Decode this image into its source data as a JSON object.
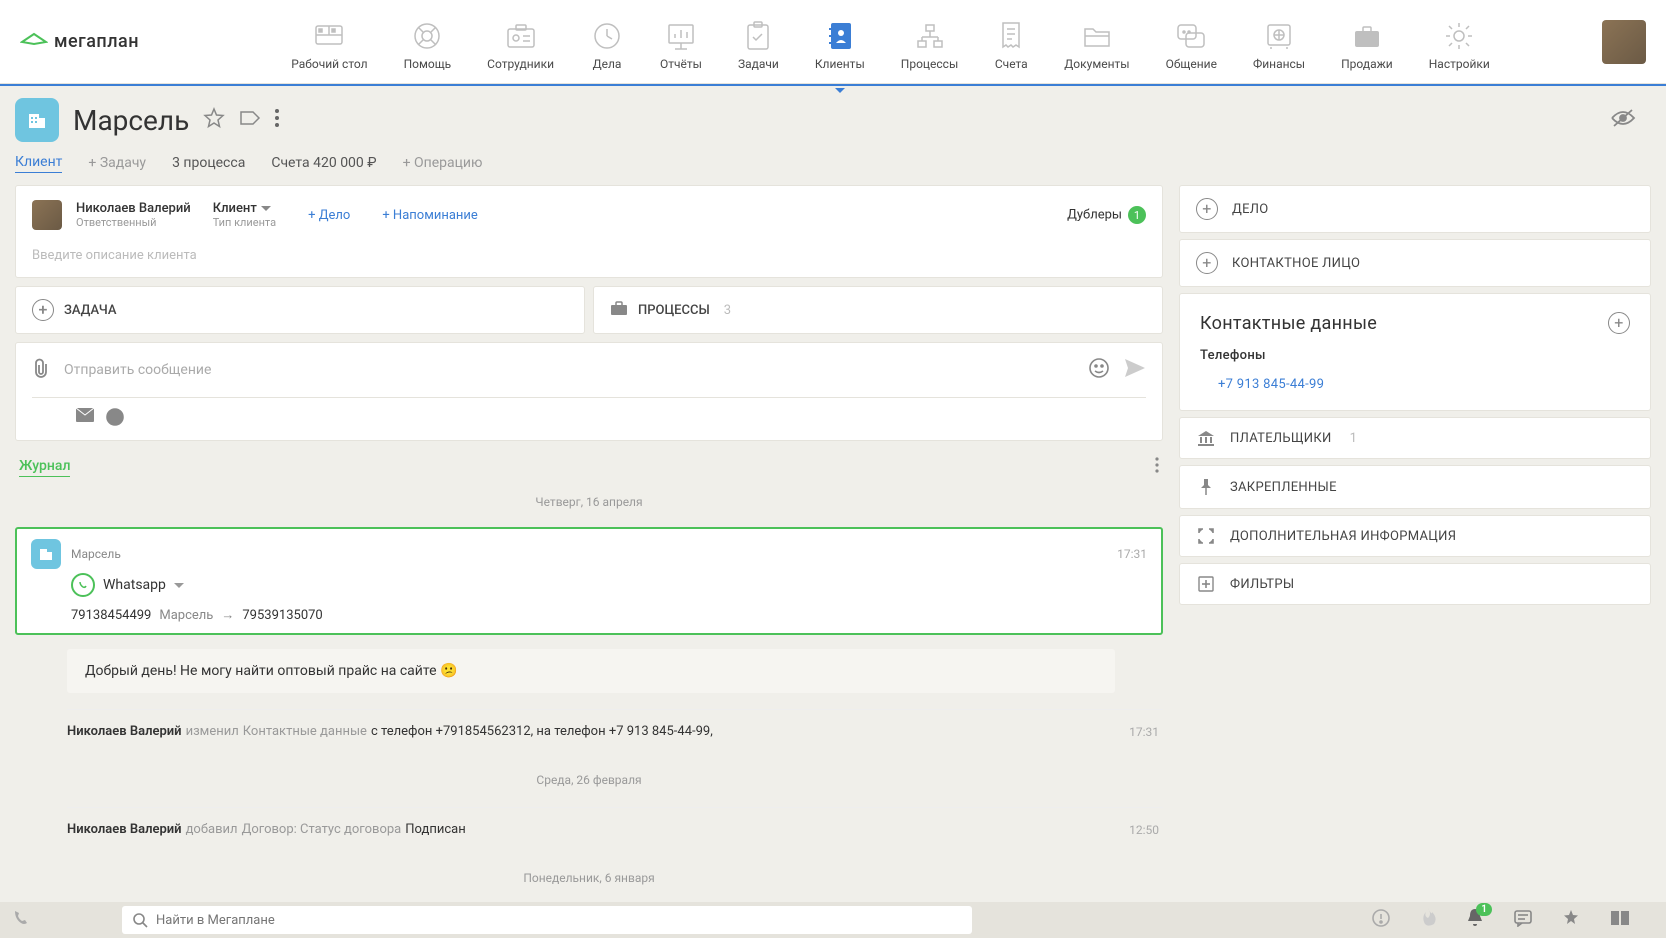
{
  "nav": {
    "items": [
      {
        "label": "Рабочий стол"
      },
      {
        "label": "Помощь"
      },
      {
        "label": "Сотрудники"
      },
      {
        "label": "Дела"
      },
      {
        "label": "Отчёты"
      },
      {
        "label": "Задачи"
      },
      {
        "label": "Клиенты"
      },
      {
        "label": "Процессы"
      },
      {
        "label": "Счета"
      },
      {
        "label": "Документы"
      },
      {
        "label": "Общение"
      },
      {
        "label": "Финансы"
      },
      {
        "label": "Продажи"
      },
      {
        "label": "Настройки"
      }
    ]
  },
  "logo_text": "мегаплан",
  "page_title": "Марсель",
  "tabs": {
    "client": "Клиент",
    "add_task": "+ Задачу",
    "processes": "3 процесса",
    "accounts": "Счета 420 000 ₽",
    "add_operation": "+ Операцию"
  },
  "responsible": {
    "name": "Николаев Валерий",
    "role": "Ответственный",
    "type_label": "Клиент",
    "type_sub": "Тип клиента",
    "add_deal": "+ Дело",
    "add_reminder": "+ Напоминание",
    "doubles": "Дублеры",
    "doubles_count": "1",
    "desc_placeholder": "Введите описание клиента"
  },
  "halves": {
    "task": "ЗАДАЧА",
    "processes": "ПРОЦЕССЫ",
    "processes_count": "3"
  },
  "message": {
    "placeholder": "Отправить сообщение"
  },
  "journal": {
    "title": "Журнал",
    "date1": "Четверг, 16 апреля",
    "entry": {
      "sender": "Марсель",
      "time": "17:31",
      "channel": "Whatsapp",
      "from_phone": "79138454499",
      "from_name": "Марсель",
      "to_phone": "79539135070"
    },
    "bubble": "Добрый день! Не могу найти оптовый прайс на сайте 😕",
    "sys1": {
      "actor": "Николаев Валерий",
      "verb": "изменил",
      "section": "Контактные данные",
      "details": "с телефон +791854562312, на телефон +7 913 845-44-99,",
      "time": "17:31"
    },
    "date2": "Среда, 26 февраля",
    "sys2": {
      "actor": "Николаев Валерий",
      "verb": "добавил",
      "section": "Договор: Статус договора",
      "value": "Подписан",
      "time": "12:50"
    },
    "date3": "Понедельник, 6 января"
  },
  "right": {
    "deal": "ДЕЛО",
    "contact_person": "КОНТАКТНОЕ ЛИЦО",
    "contact_data_title": "Контактные данные",
    "phones_label": "Телефоны",
    "phone": "+7 913 845-44-99",
    "payers": "ПЛАТЕЛЬЩИКИ",
    "payers_count": "1",
    "pinned": "ЗАКРЕПЛЕННЫЕ",
    "additional": "ДОПОЛНИТЕЛЬНАЯ ИНФОРМАЦИЯ",
    "filters": "ФИЛЬТРЫ"
  },
  "bottom": {
    "search_placeholder": "Найти в Мегаплане",
    "notif_count": "1"
  }
}
